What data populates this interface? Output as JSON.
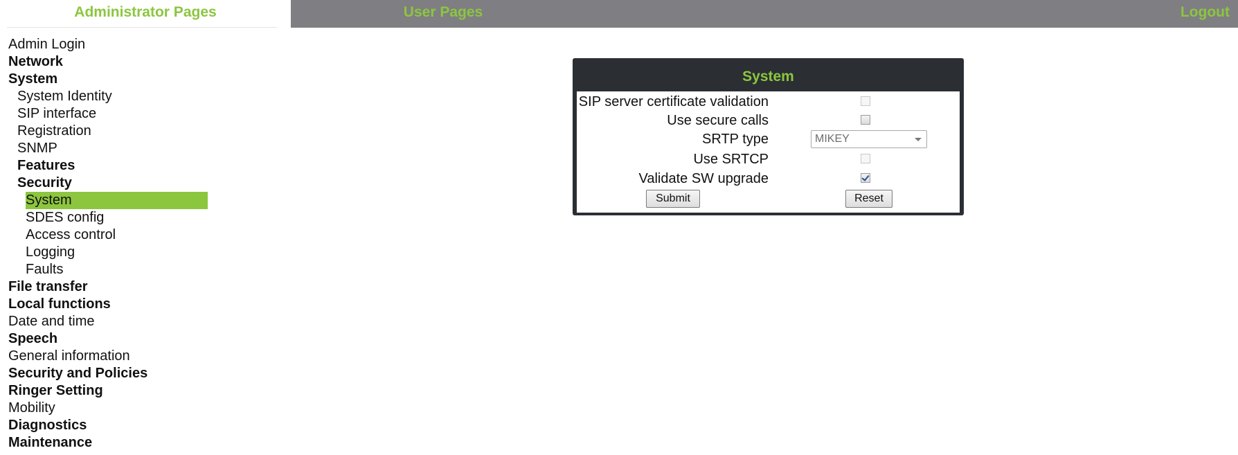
{
  "tabs": {
    "admin": "Administrator Pages",
    "user": "User Pages",
    "logout": "Logout"
  },
  "sidebar": {
    "items": [
      {
        "label": "Admin Login"
      },
      {
        "label": "Network"
      },
      {
        "label": "System"
      },
      {
        "label": "System Identity"
      },
      {
        "label": "SIP interface"
      },
      {
        "label": "Registration"
      },
      {
        "label": "SNMP"
      },
      {
        "label": "Features"
      },
      {
        "label": "Security"
      },
      {
        "label": "System"
      },
      {
        "label": "SDES config"
      },
      {
        "label": "Access control"
      },
      {
        "label": "Logging"
      },
      {
        "label": "Faults"
      },
      {
        "label": "File transfer"
      },
      {
        "label": "Local functions"
      },
      {
        "label": "Date and time"
      },
      {
        "label": "Speech"
      },
      {
        "label": "General information"
      },
      {
        "label": "Security and Policies"
      },
      {
        "label": "Ringer Setting"
      },
      {
        "label": "Mobility"
      },
      {
        "label": "Diagnostics"
      },
      {
        "label": "Maintenance"
      }
    ]
  },
  "panel": {
    "title": "System",
    "fields": {
      "sip_cert": {
        "label": "SIP server certificate validation",
        "checked": false,
        "disabled": true
      },
      "secure_calls": {
        "label": "Use secure calls",
        "checked": false
      },
      "srtp_type": {
        "label": "SRTP type",
        "value": "MIKEY"
      },
      "use_srtcp": {
        "label": "Use SRTCP",
        "checked": false,
        "disabled": true
      },
      "validate_sw": {
        "label": "Validate SW upgrade",
        "checked": true
      }
    },
    "submit_label": "Submit",
    "reset_label": "Reset"
  },
  "colors": {
    "accent": "#8cc63f",
    "topbar": "#7f7e82",
    "panel_frame": "#2b2f33"
  }
}
